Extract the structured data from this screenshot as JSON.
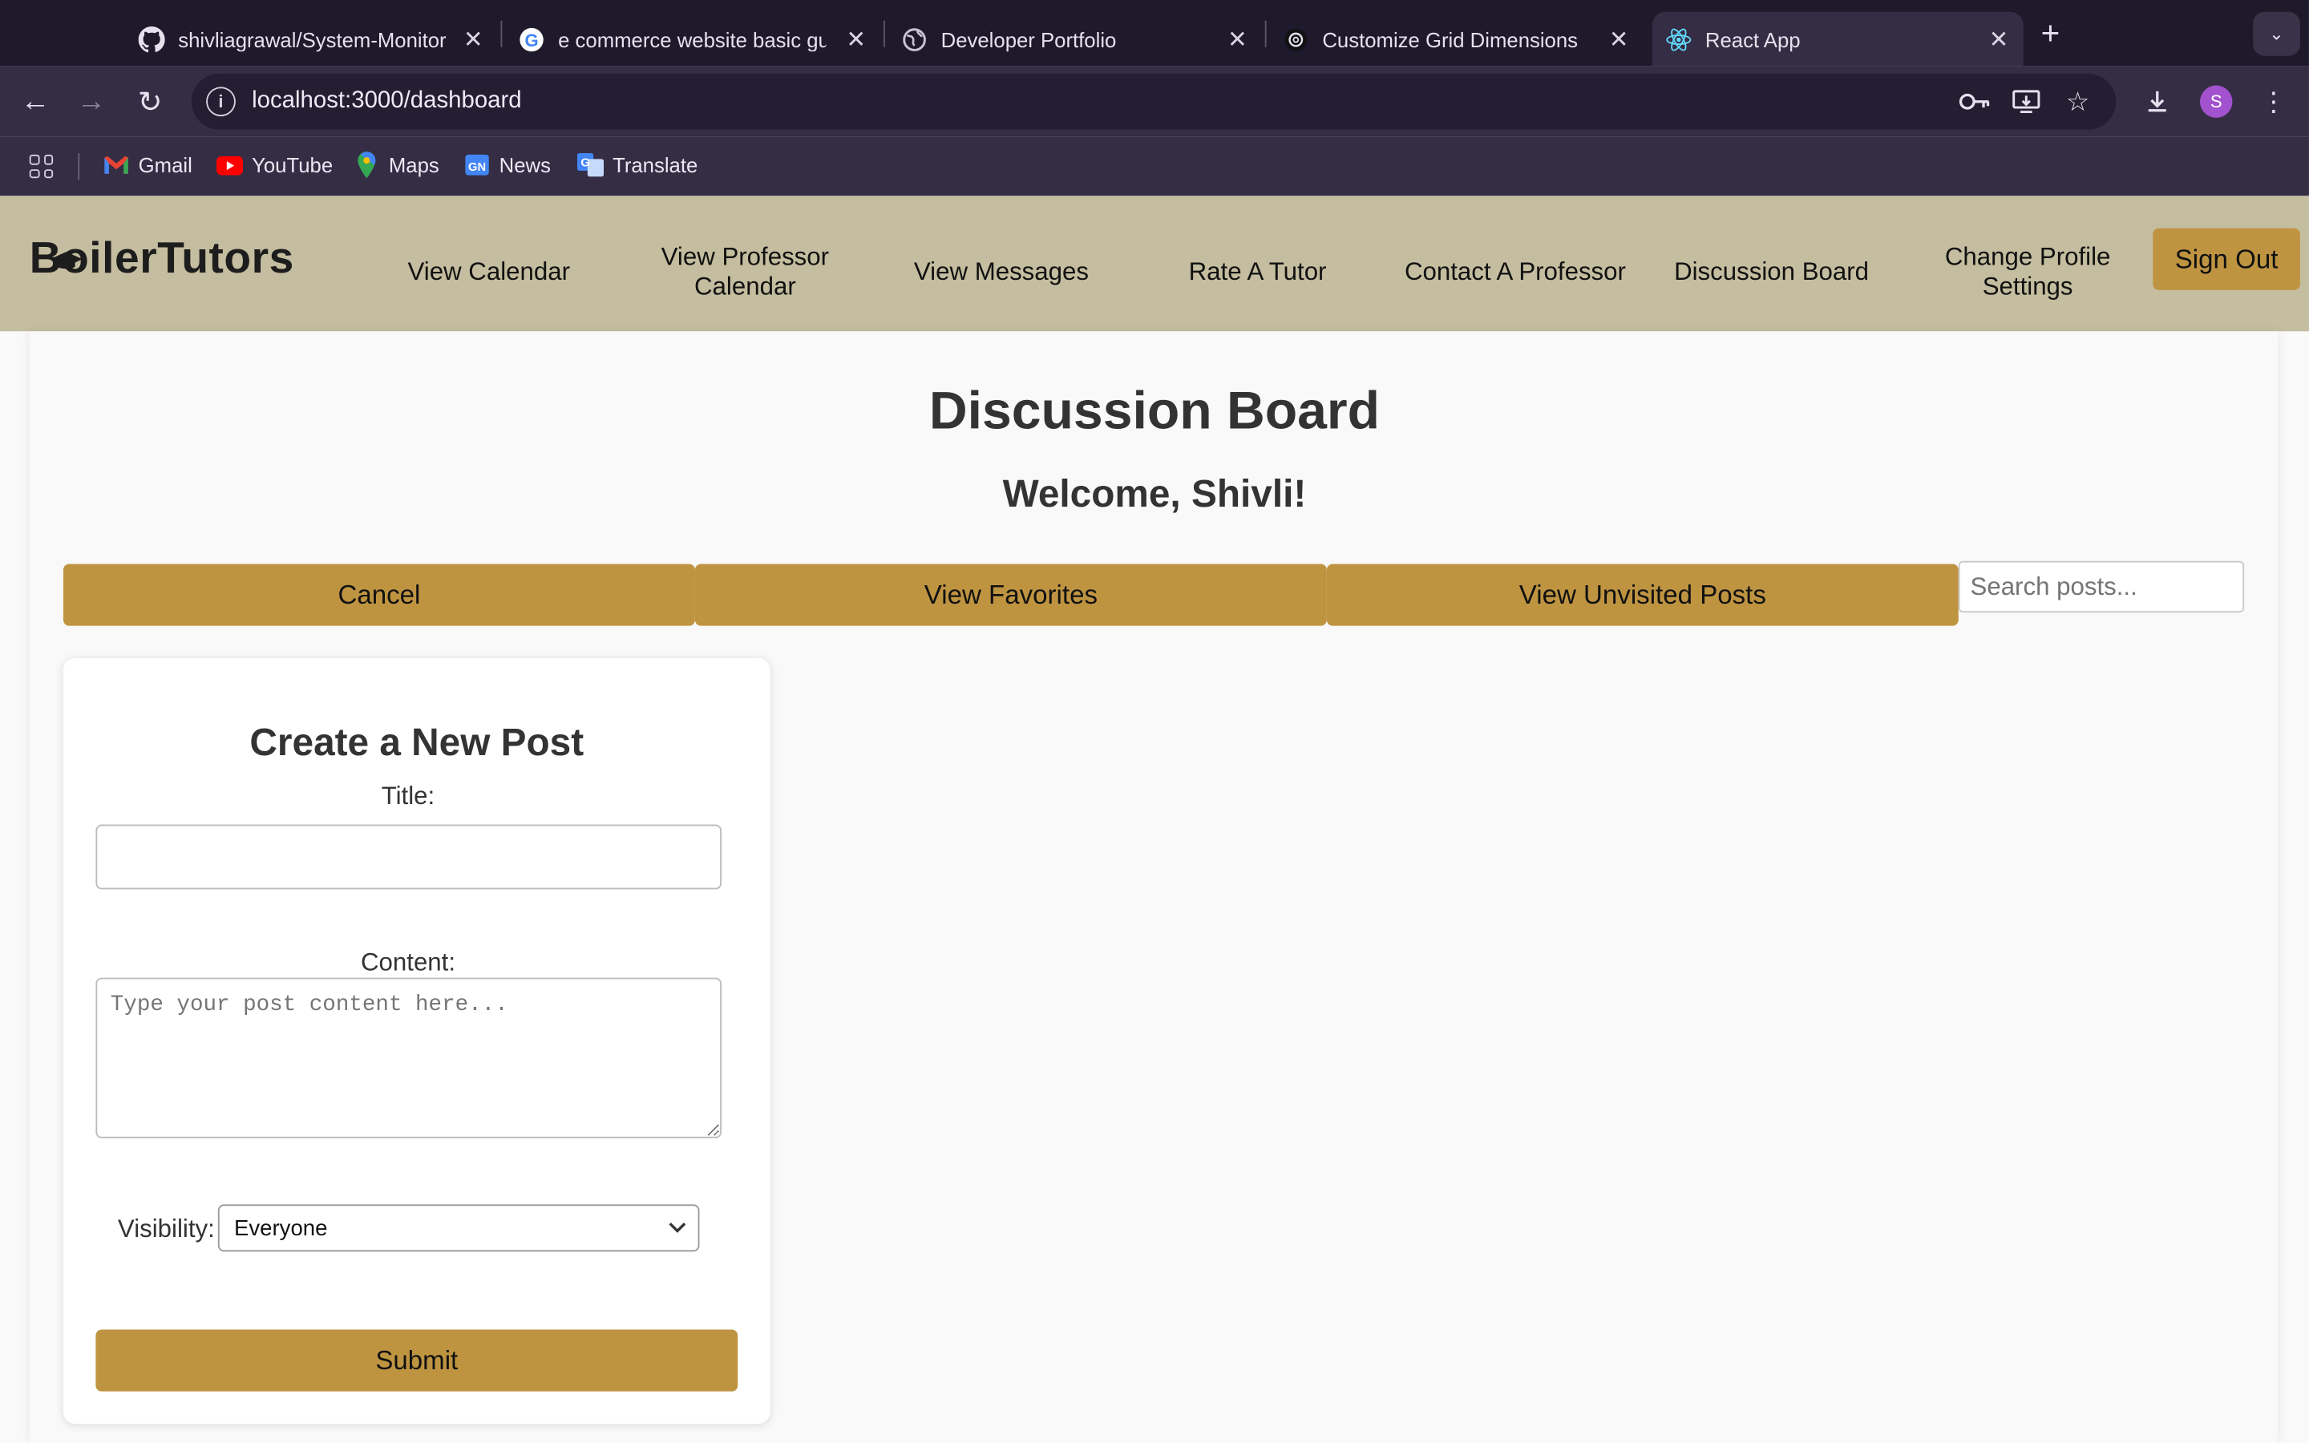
{
  "browser": {
    "tabs": [
      {
        "title": "shivliagrawal/System-Monitor",
        "icon": "github-icon"
      },
      {
        "title": "e commerce website basic gu",
        "icon": "google-icon"
      },
      {
        "title": "Developer Portfolio",
        "icon": "globe-icon"
      },
      {
        "title": "Customize Grid Dimensions",
        "icon": "chatgpt-icon"
      },
      {
        "title": "React App",
        "icon": "react-icon",
        "active": true
      }
    ],
    "url": "localhost:3000/dashboard",
    "profile_initial": "S",
    "bookmarks": [
      {
        "label": "Gmail",
        "icon": "gmail-icon"
      },
      {
        "label": "YouTube",
        "icon": "youtube-icon"
      },
      {
        "label": "Maps",
        "icon": "maps-icon"
      },
      {
        "label": "News",
        "icon": "news-icon"
      },
      {
        "label": "Translate",
        "icon": "translate-icon"
      }
    ]
  },
  "app": {
    "logo": "BoilerTutors",
    "nav": [
      "View Calendar",
      "View Professor Calendar",
      "View Messages",
      "Rate A Tutor",
      "Contact A Professor",
      "Discussion Board",
      "Change Profile Settings"
    ],
    "sign_out": "Sign Out",
    "page_title": "Discussion Board",
    "welcome": "Welcome, Shivli!",
    "actions": [
      "Cancel",
      "View Favorites",
      "View Unvisited Posts"
    ],
    "search_placeholder": "Search posts...",
    "form": {
      "heading": "Create a New Post",
      "title_label": "Title:",
      "title_value": "",
      "content_label": "Content:",
      "content_placeholder": "Type your post content here...",
      "visibility_label": "Visibility:",
      "visibility_value": "Everyone",
      "submit": "Submit"
    },
    "colors": {
      "accent": "#bf9441",
      "navbar": "#c4bd9f"
    }
  }
}
